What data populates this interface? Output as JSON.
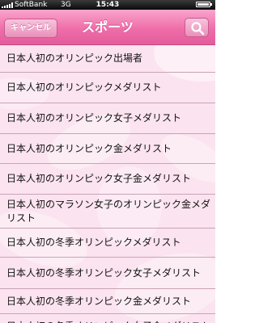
{
  "status_bar": {
    "carrier": "SoftBank",
    "network": "3G",
    "time": "15:43"
  },
  "nav": {
    "cancel_label": "キャンセル",
    "title": "スポーツ",
    "search_icon": "search-icon"
  },
  "list": {
    "items": [
      {
        "label": "日本人初のオリンピック出場者"
      },
      {
        "label": "日本人初のオリンピックメダリスト"
      },
      {
        "label": "日本人初のオリンピック女子メダリスト"
      },
      {
        "label": "日本人初のオリンピック金メダリスト"
      },
      {
        "label": "日本人初のオリンピック女子金メダリスト"
      },
      {
        "label": "日本人初のマラソン女子のオリンピック金メダリスト"
      },
      {
        "label": "日本人初の冬季オリンピックメダリスト"
      },
      {
        "label": "日本人初の冬季オリンピック女子メダリスト"
      },
      {
        "label": "日本人初の冬季オリンピック金メダリスト"
      },
      {
        "label": "日本人初の冬季オリンピック女子金メダリスト"
      }
    ]
  },
  "colors": {
    "nav_pink": "#ee6ea9",
    "background_pink": "#fbe3ef",
    "separator": "#c9a3b6"
  }
}
